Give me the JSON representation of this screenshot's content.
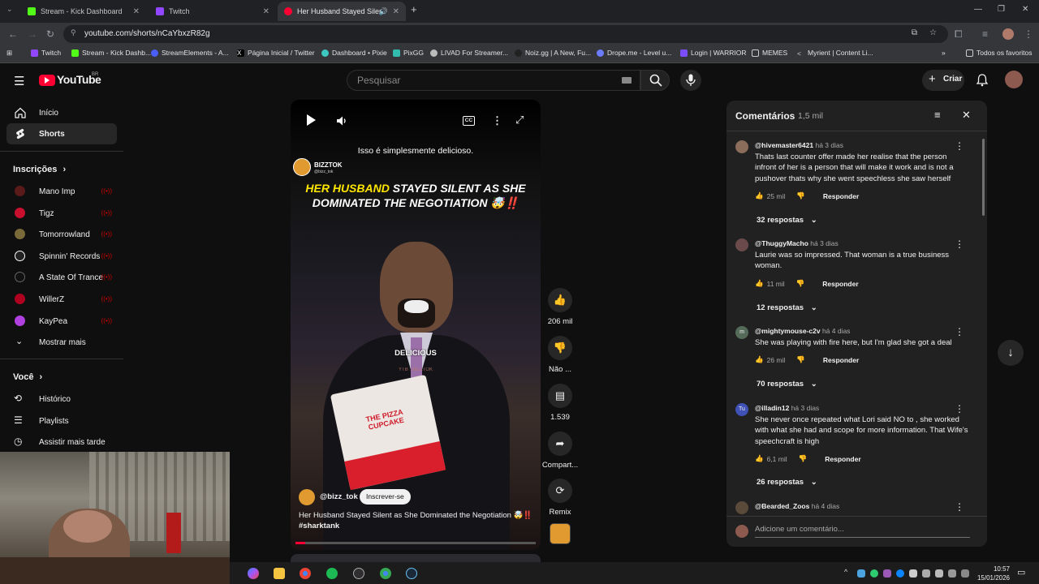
{
  "browser": {
    "tabs": [
      {
        "title": "Stream - Kick Dashboard",
        "color": "#53fc18"
      },
      {
        "title": "Twitch",
        "color": "#9146ff"
      },
      {
        "title": "Her Husband Stayed Silen",
        "color": "#ff0033"
      }
    ],
    "url": "youtube.com/shorts/nCaYbxzR82g",
    "bookmarks": [
      "Twitch",
      "Stream - Kick Dashb...",
      "StreamElements - A...",
      "Página Inicial / Twitter",
      "Dashboard • Pixie",
      "PixGG",
      "LIVAD For Streamer...",
      "Noiz.gg | A New, Fu...",
      "Drope.me - Level u...",
      "Login | WARRIOR",
      "MEMES",
      "Myrient | Content Li..."
    ],
    "all_bookmarks": "Todos os favoritos"
  },
  "youtube": {
    "logo": "YouTube",
    "region": "BR",
    "search_placeholder": "Pesquisar",
    "create_label": "Criar"
  },
  "sidebar": {
    "items": [
      {
        "label": "Início",
        "icon": "home-icon"
      },
      {
        "label": "Shorts",
        "icon": "shorts-icon"
      }
    ],
    "subscriptions_title": "Inscrições",
    "subscriptions": [
      {
        "name": "Mano Imp",
        "color": "#5b1a1a"
      },
      {
        "name": "Tigz",
        "color": "#c8102e"
      },
      {
        "name": "Tomorrowland",
        "color": "#7a6a3a"
      },
      {
        "name": "Spinnin' Records",
        "color": "#222222"
      },
      {
        "name": "A State Of Trance",
        "color": "#111111"
      },
      {
        "name": "WillerZ",
        "color": "#b00020"
      },
      {
        "name": "KayPea",
        "color": "#b040e0"
      }
    ],
    "show_more": "Mostrar mais",
    "you_title": "Você",
    "you_items": [
      "Histórico",
      "Playlists",
      "Assistir mais tarde"
    ]
  },
  "video": {
    "caption_top": "Isso é simplesmente delicioso.",
    "channel_overlay": "BIZZTOK",
    "channel_handle_small": "@bizz_tok",
    "headline_yellow": "HER HUSBAND",
    "headline_white1": " STAYED SILENT AS SHE",
    "headline_white2": "DOMINATED THE NEGOTIATION",
    "headline_emoji": "🤯‼️",
    "subtitle_overlay": "DELICIOUS",
    "watermark": "YTB : BIZZTOK",
    "box_text": "THE PIZZA CUPCAKE",
    "channel": "@bizz_tok",
    "subscribe": "Inscrever-se",
    "title": "Her Husband Stayed Silent as She Dominated the Negotiation 🤯‼️",
    "hashtag": "#sharktank",
    "cc_label": "CC"
  },
  "actions": {
    "likes": "206 mil",
    "dislike": "Não ...",
    "comments": "1.539",
    "share": "Compart...",
    "remix": "Remix"
  },
  "comments_panel": {
    "title": "Comentários",
    "count": "1,5 mil",
    "add_placeholder": "Adicione um comentário...",
    "reply_label": "Responder",
    "comments": [
      {
        "author": "@hivemaster6421",
        "time": "há 3 dias",
        "text": "Thats last counter offer made her realise that the person infront of her is a person that will make it work and is not a pushover thats why she went speechless she saw herself",
        "likes": "25 mil",
        "replies": "32 respostas",
        "color": "#8a6d5a"
      },
      {
        "author": "@ThuggyMacho",
        "time": "há 3 dias",
        "text": "Laurie was so impressed. That woman is a true business woman.",
        "likes": "11 mil",
        "replies": "12 respostas",
        "color": "#6a4a4a"
      },
      {
        "author": "@mightymouse-c2v",
        "time": "há 4 dias",
        "text": "She was playing with fire here, but I'm glad she got a deal",
        "likes": "26 mil",
        "replies": "70 respostas",
        "color": "#556b5a",
        "initial": "m"
      },
      {
        "author": "@illadin12",
        "time": "há 3 dias",
        "text": "She never once repeated what Lori said NO to , she worked with what she had and scope for more information. That Wife's speechcraft is high",
        "likes": "6,1 mil",
        "replies": "26 respostas",
        "color": "#3f51b5",
        "initial": "Tu"
      },
      {
        "author": "@Bearded_Zoos",
        "time": "há 4 dias",
        "color": "#5a4a3a"
      }
    ]
  },
  "taskbar": {
    "time": "10:57",
    "date": "15/01/2026"
  }
}
